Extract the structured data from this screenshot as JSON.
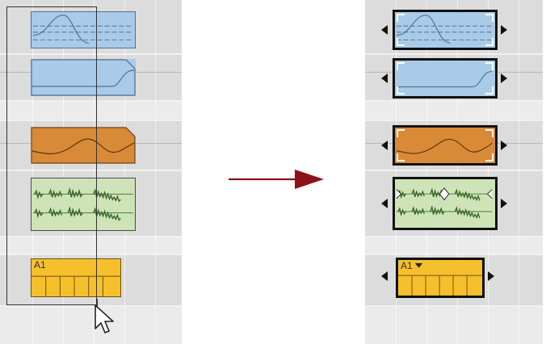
{
  "colors": {
    "automation_clip": "#aacbe8",
    "automation_clip_border": "#4f6f8f",
    "modulation_clip": "#d98a37",
    "audio_clip": "#cfe3b8",
    "audio_wave": "#4f7a3c",
    "midi_clip": "#f6c02c",
    "arrow": "#8b1218",
    "track_dark": "#dcdcdc",
    "track_light": "#ebebeb"
  },
  "clips": {
    "midi_clip_name": "A1"
  },
  "icons": {
    "cursor": "mouse-pointer-icon",
    "transition": "arrow-right-icon",
    "resize_left": "triangle-left-icon",
    "resize_right": "triangle-right-icon"
  }
}
